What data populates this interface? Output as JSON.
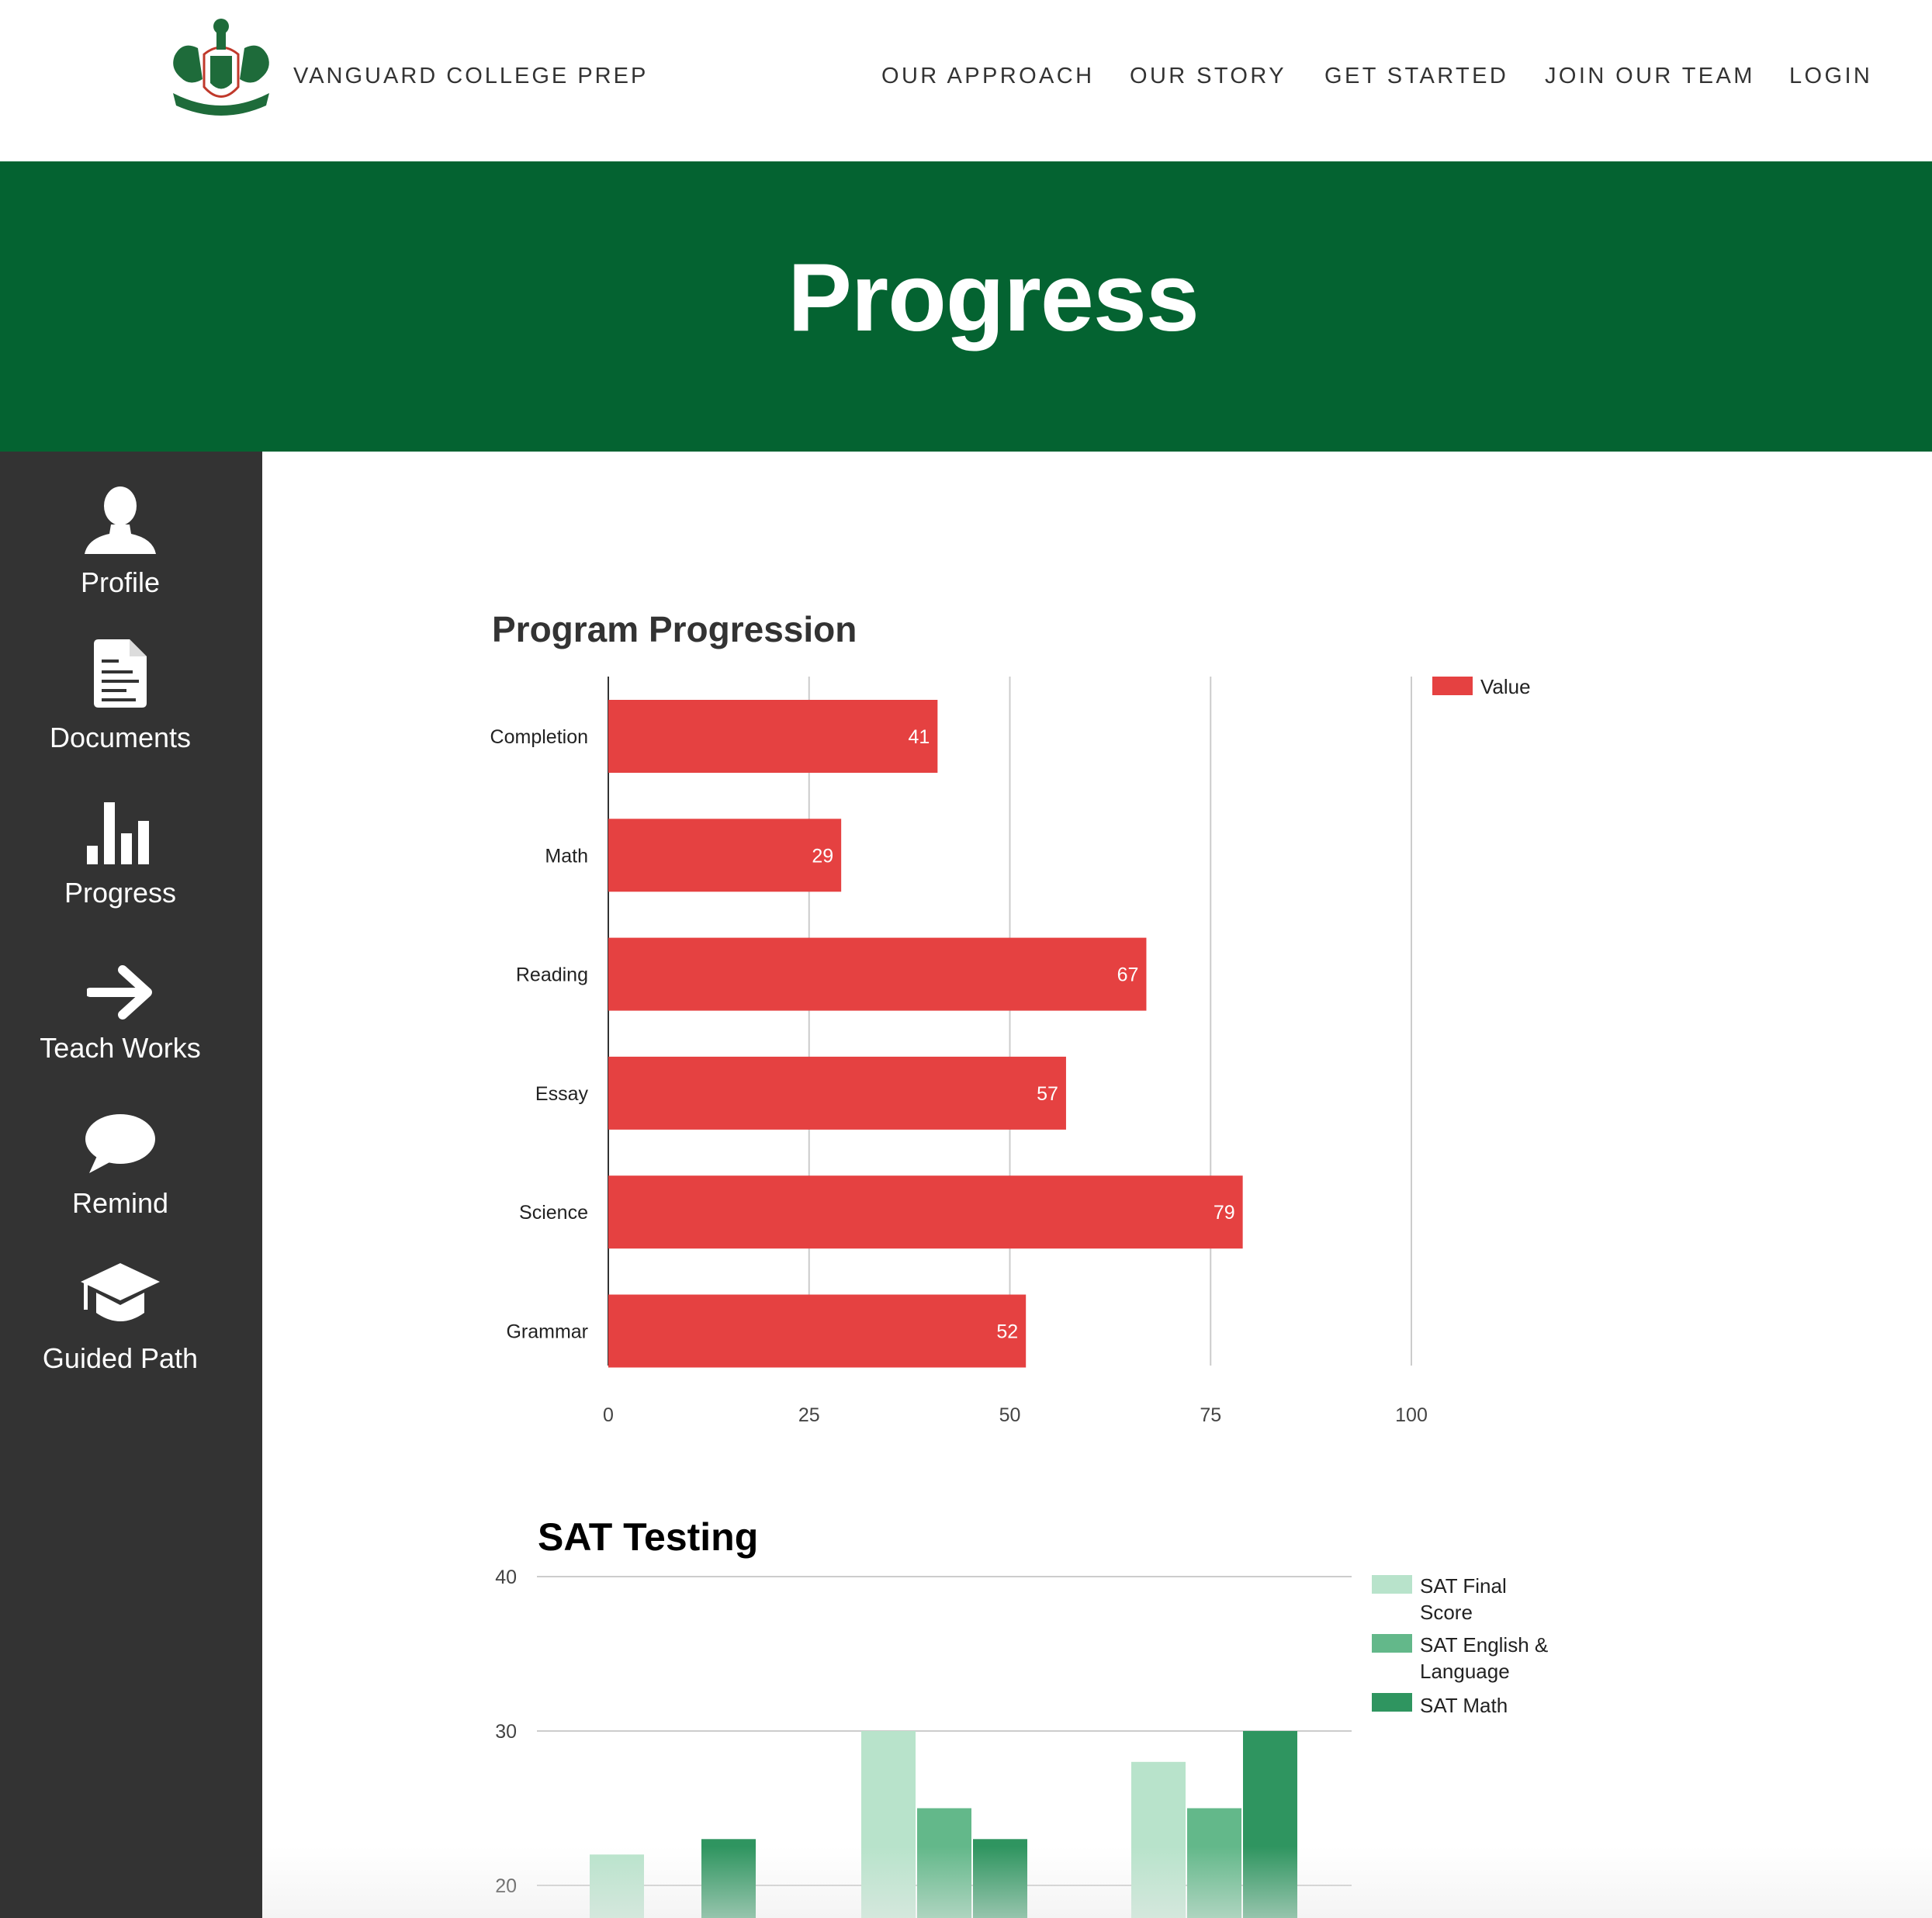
{
  "header": {
    "brand": "VANGUARD COLLEGE PREP",
    "logo_icon": "vanguard-crest-logo",
    "nav": [
      "OUR APPROACH",
      "OUR STORY",
      "GET STARTED",
      "JOIN OUR TEAM",
      "LOGIN"
    ]
  },
  "banner": {
    "title": "Progress",
    "color": "#046331"
  },
  "sidebar": {
    "items": [
      {
        "label": "Profile",
        "icon": "user-icon"
      },
      {
        "label": "Documents",
        "icon": "document-icon"
      },
      {
        "label": "Progress",
        "icon": "bar-chart-icon"
      },
      {
        "label": "Teach Works",
        "icon": "arrow-right-icon"
      },
      {
        "label": "Remind",
        "icon": "chat-bubble-icon"
      },
      {
        "label": "Guided Path",
        "icon": "graduation-cap-icon"
      }
    ]
  },
  "chart_data": [
    {
      "type": "bar",
      "orientation": "horizontal",
      "title": "Program Progression",
      "categories": [
        "Completion",
        "Math",
        "Reading",
        "Essay",
        "Science",
        "Grammar"
      ],
      "series": [
        {
          "name": "Value",
          "values": [
            41,
            29,
            67,
            57,
            79,
            52
          ],
          "color": "#e54141"
        }
      ],
      "xlim": [
        0,
        100
      ],
      "xticks": [
        "0",
        "25",
        "50",
        "75",
        "100"
      ],
      "data_labels": true,
      "grid": true,
      "legend": "top-right"
    },
    {
      "type": "bar",
      "title": "SAT Testing",
      "categories": [
        "",
        "",
        ""
      ],
      "series": [
        {
          "name": "SAT Final Score",
          "values": [
            22,
            30,
            28
          ],
          "color": "#b8e3cb"
        },
        {
          "name": "SAT English & Language",
          "values": [
            null,
            25,
            25
          ],
          "color": "#63b88a"
        },
        {
          "name": "SAT Math",
          "values": [
            23,
            23,
            30
          ],
          "color": "#2f9560"
        }
      ],
      "yticks": [
        "40",
        "30",
        "20"
      ],
      "ylim": [
        20,
        40
      ],
      "grid": true,
      "legend": "top-right"
    }
  ]
}
